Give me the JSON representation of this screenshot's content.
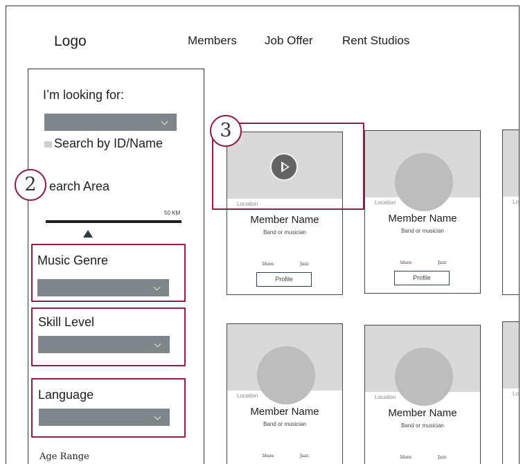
{
  "header": {
    "logo": "Logo",
    "nav": [
      "Members",
      "Job Offer",
      "Rent Studios"
    ]
  },
  "sidebar": {
    "looking_for_label": "I’m looking for:",
    "search_by_id_label": "Search by ID/Name",
    "search_area_label": "earch Area",
    "slider_value": "50 KM",
    "music_genre_label": "Music Genre",
    "skill_level_label": "Skill Level",
    "language_label": "Language",
    "age_range_label": "Age Range"
  },
  "annotations": {
    "badge_2": "2",
    "badge_3": "3"
  },
  "cards": [
    {
      "location": "Location",
      "name": "Member Name",
      "subtitle": "Band or musician",
      "tags": [
        "blues",
        "Jazz"
      ],
      "button": "Profile"
    },
    {
      "location": "Location",
      "name": "Member Name",
      "subtitle": "Band or musician",
      "tags": [
        "blues",
        "Jazz"
      ],
      "button": "Profile"
    },
    {
      "location": "Location",
      "name": "Member Name",
      "subtitle": "Band or musician",
      "tags": [
        "blues",
        "Jazz"
      ]
    },
    {
      "location": "Location",
      "name": "Member Name",
      "subtitle": "Band or musician",
      "tags": [
        "blues",
        "Jazz"
      ]
    }
  ],
  "partial_cards": [
    {
      "location": "Lo"
    },
    {
      "location": "Lo"
    }
  ],
  "colors": {
    "accent": "#8c1d40",
    "dropdown": "#7f868a",
    "placeholder": "#d9d9d9",
    "avatar": "#bdbdbd"
  }
}
